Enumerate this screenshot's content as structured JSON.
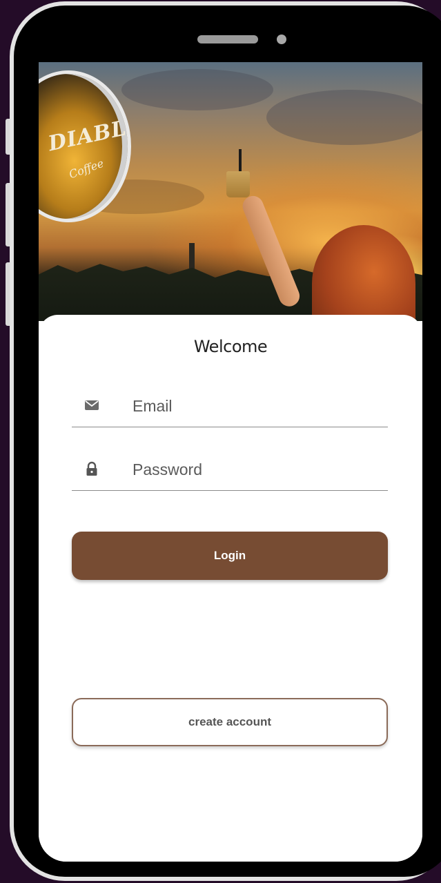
{
  "brand": {
    "logo_text": "DIABLO",
    "logo_subtext": "Coffee"
  },
  "login": {
    "title": "Welcome",
    "email_placeholder": "Email",
    "email_value": "",
    "password_placeholder": "Password",
    "password_value": "",
    "login_label": "Login",
    "create_account_label": "create account"
  },
  "icons": {
    "email": "envelope-icon",
    "password": "lock-icon"
  },
  "colors": {
    "background": "#240c28",
    "primary_button": "#774c33",
    "secondary_border": "#8a6a58",
    "card": "#ffffff"
  }
}
